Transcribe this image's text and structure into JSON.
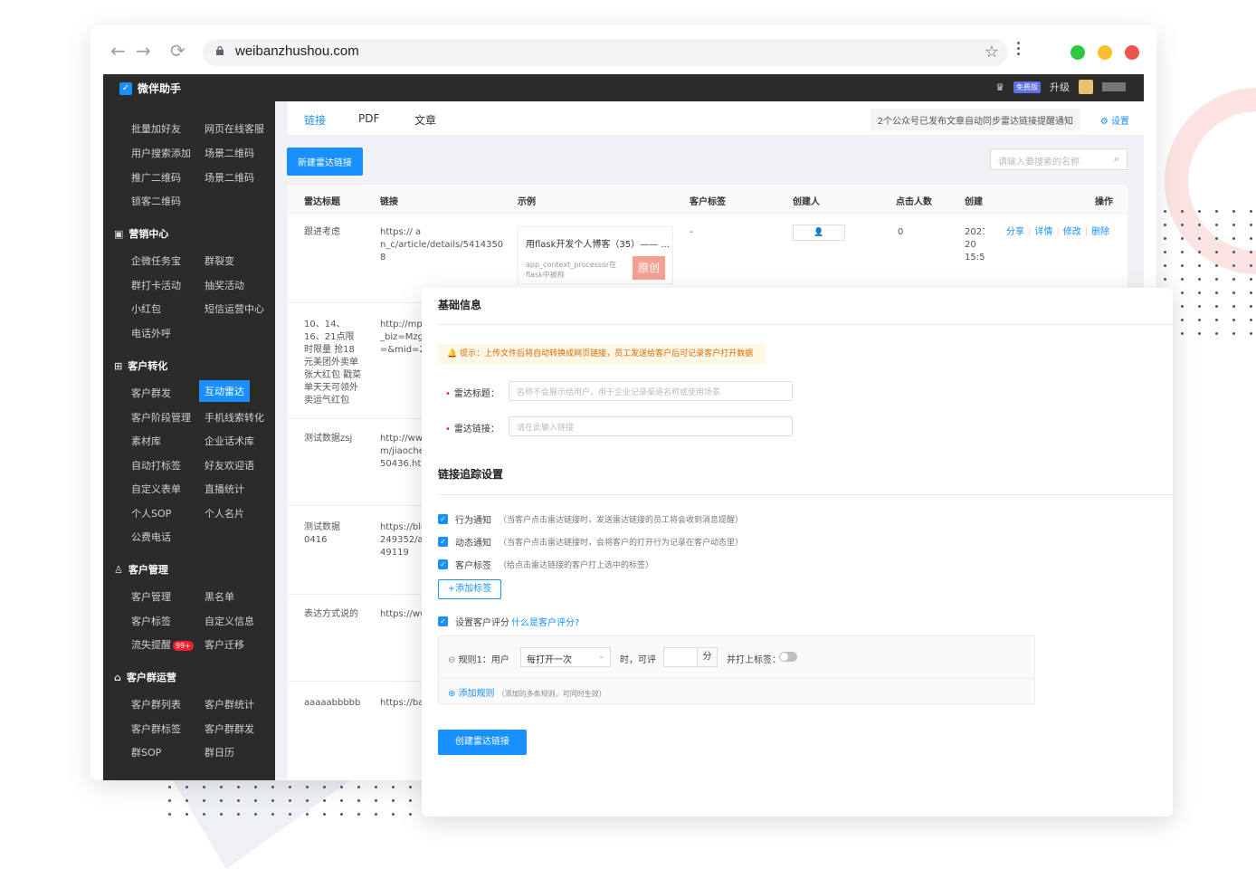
{
  "browser": {
    "url": "weibanzhushou.com"
  },
  "app": {
    "brand": "微伴助手",
    "free_badge": "免费版",
    "upgrade": "升级"
  },
  "sidebar": {
    "top_items": [
      [
        "批量加好友",
        "网页在线客服"
      ],
      [
        "用户搜索添加",
        "场景二维码"
      ],
      [
        "推广二维码",
        "场景二维码"
      ],
      [
        "锁客二维码",
        ""
      ]
    ],
    "sections": [
      {
        "title": "营销中心",
        "rows": [
          [
            "企微任务宝",
            "群裂变"
          ],
          [
            "群打卡活动",
            "抽奖活动"
          ],
          [
            "小红包",
            "短信运营中心"
          ],
          [
            "电话外呼",
            ""
          ]
        ]
      },
      {
        "title": "客户转化",
        "rows": [
          [
            "客户群发",
            "互动雷达"
          ],
          [
            "客户阶段管理",
            "手机线索转化"
          ],
          [
            "素材库",
            "企业话术库"
          ],
          [
            "自动打标签",
            "好友欢迎语"
          ],
          [
            "自定义表单",
            "直播统计"
          ],
          [
            "个人SOP",
            "个人名片"
          ],
          [
            "公费电话",
            ""
          ]
        ]
      },
      {
        "title": "客户管理",
        "rows": [
          [
            "客户管理",
            "黑名单"
          ],
          [
            "客户标签",
            "自定义信息"
          ],
          [
            "流失提醒",
            "客户迁移"
          ]
        ]
      },
      {
        "title": "客户群运营",
        "rows": [
          [
            "客户群列表",
            "客户群统计"
          ],
          [
            "客户群标签",
            "客户群群发"
          ],
          [
            "群SOP",
            "群日历"
          ]
        ]
      }
    ],
    "active_item": "互动雷达",
    "loss_badge": "99+"
  },
  "main": {
    "tabs": [
      "链接",
      "PDF",
      "文章"
    ],
    "notice": "2个公众号已发布文章自动同步雷达链接提醒通知",
    "settings": "设置",
    "new_button": "新建雷达链接",
    "search_placeholder": "请输入要搜索的名称"
  },
  "table": {
    "headers": [
      "雷达标题",
      "链接",
      "示例",
      "客户标签",
      "创建人",
      "点击人数",
      "创建",
      "操作"
    ],
    "row1": {
      "title": "跟进考虑",
      "link": "https://                    a n_c/article/details/5414350 8",
      "example_title": "用flask开发个人博客（35）—— ...",
      "example_desc": "app_context_processor在flask中被称",
      "example_badge": "原创",
      "tag": "-",
      "clicks": "0",
      "created": "2021 20 15:5",
      "ops": [
        "分享",
        "详情",
        "修改",
        "删除"
      ]
    },
    "row2": {
      "title": "10、14、16、21点限时限量 抢18元美团外卖单张大红包 戳菜单天天可领外卖运气红包",
      "link": "http://mp.w _biz=Mzg =&mid=22"
    },
    "row3": {
      "title": "测试数据zsj",
      "link": "http://www m/jiaocher 50436.htm"
    },
    "row4": {
      "title": "测试数据 0416",
      "link": "https://blo 249352/a 49119"
    },
    "row5": {
      "title": "表达方式说的",
      "link": "https://ww"
    },
    "row6": {
      "title": "aaaaabbbbb",
      "link": "https://bai"
    }
  },
  "panel": {
    "section1": "基础信息",
    "tip": "提示：上传文件后将自动转换成网页链接，员工发送给客户后可记录客户打开数据",
    "title_label": "雷达标题：",
    "title_placeholder": "名称不会展示给用户，用于企业记录渠道名称或使用场景",
    "link_label": "雷达链接：",
    "link_placeholder": "请在此输入链接",
    "section2": "链接追踪设置",
    "options": [
      {
        "label": "行为通知",
        "hint": "（当客户点击雷达链接时，发送雷达链接的员工将会收到消息提醒）"
      },
      {
        "label": "动态通知",
        "hint": "（当客户点击雷达链接时，会将客户的打开行为记录在客户动态里）"
      },
      {
        "label": "客户标签",
        "hint": "（给点击雷达链接的客户打上选中的标签）"
      }
    ],
    "add_tag": "+添加标签",
    "score_label": "设置客户评分",
    "score_link": "什么是客户评分?",
    "rule_prefix": "规则1：用户",
    "rule_select": "每打开一次",
    "rule_mid": "时，可评",
    "rule_unit": "分",
    "rule_tag": "并打上标签：",
    "add_rule": "添加规则",
    "add_rule_hint": "（添加的多条规则，可同时生效）",
    "create_button": "创建雷达链接"
  },
  "colors": {
    "accent": "#1890ff",
    "sidebar": "#2b2b2b",
    "tip_bg": "#fff7e6"
  }
}
